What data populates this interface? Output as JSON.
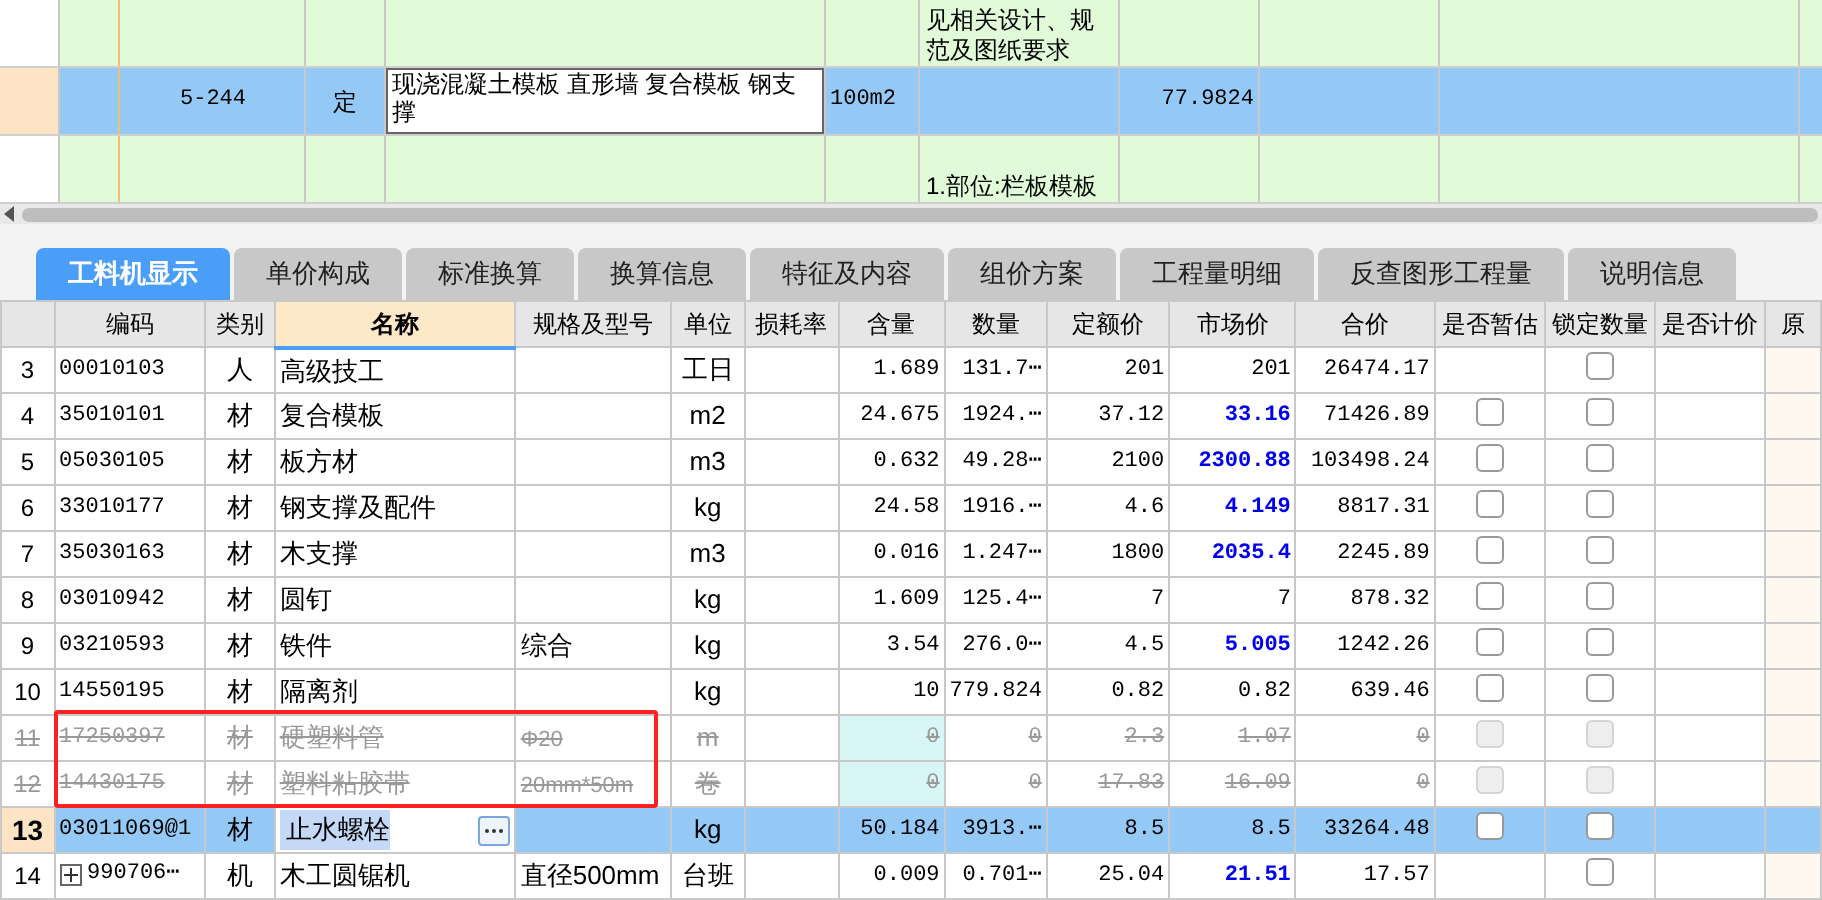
{
  "upper_grid": {
    "rows": [
      {
        "code": "",
        "type": "",
        "name": "",
        "unit": "",
        "description": "见相关设计、规范及图纸要求",
        "amount": "",
        "selected": false
      },
      {
        "code": "5-244",
        "type": "定",
        "name": "现浇混凝土模板 直形墙 复合模板 钢支撑",
        "unit": "100m2",
        "description": "",
        "amount": "77.9824",
        "selected": true
      },
      {
        "code": "",
        "type": "",
        "name": "",
        "unit": "",
        "description": "1.部位:栏板模板",
        "amount": "",
        "selected": false
      }
    ]
  },
  "tabs": [
    {
      "label": "工料机显示",
      "selected": true
    },
    {
      "label": "单价构成",
      "selected": false
    },
    {
      "label": "标准换算",
      "selected": false
    },
    {
      "label": "换算信息",
      "selected": false
    },
    {
      "label": "特征及内容",
      "selected": false
    },
    {
      "label": "组价方案",
      "selected": false
    },
    {
      "label": "工程量明细",
      "selected": false
    },
    {
      "label": "反查图形工程量",
      "selected": false
    },
    {
      "label": "说明信息",
      "selected": false
    }
  ],
  "table": {
    "columns": [
      {
        "label": "编码",
        "sorted": false
      },
      {
        "label": "类别",
        "sorted": false
      },
      {
        "label": "名称",
        "sorted": true
      },
      {
        "label": "规格及型号",
        "sorted": false
      },
      {
        "label": "单位",
        "sorted": false
      },
      {
        "label": "损耗率",
        "sorted": false
      },
      {
        "label": "含量",
        "sorted": false
      },
      {
        "label": "数量",
        "sorted": false
      },
      {
        "label": "定额价",
        "sorted": false
      },
      {
        "label": "市场价",
        "sorted": false
      },
      {
        "label": "合价",
        "sorted": false
      },
      {
        "label": "是否暂估",
        "sorted": false
      },
      {
        "label": "锁定数量",
        "sorted": false
      },
      {
        "label": "是否计价",
        "sorted": false
      },
      {
        "label": "原",
        "sorted": false
      }
    ],
    "rows": [
      {
        "no": "3",
        "code": "00010103",
        "type": "人",
        "name": "高级技工",
        "spec": "",
        "unit": "工日",
        "qty": "1.689",
        "amount": "131.7⋯",
        "quota": "201",
        "market": "201",
        "market_changed": false,
        "total": "26474.17",
        "estimate": null,
        "lock": {
          "checked": false
        },
        "struck": false,
        "selected": false,
        "expandable": false
      },
      {
        "no": "4",
        "code": "35010101",
        "type": "材",
        "name": "复合模板",
        "spec": "",
        "unit": "m2",
        "qty": "24.675",
        "amount": "1924.⋯",
        "quota": "37.12",
        "market": "33.16",
        "market_changed": true,
        "total": "71426.89",
        "estimate": {
          "checked": false
        },
        "lock": {
          "checked": false
        },
        "struck": false,
        "selected": false,
        "expandable": false
      },
      {
        "no": "5",
        "code": "05030105",
        "type": "材",
        "name": "板方材",
        "spec": "",
        "unit": "m3",
        "qty": "0.632",
        "amount": "49.28⋯",
        "quota": "2100",
        "market": "2300.88",
        "market_changed": true,
        "total": "103498.24",
        "estimate": {
          "checked": false
        },
        "lock": {
          "checked": false
        },
        "struck": false,
        "selected": false,
        "expandable": false
      },
      {
        "no": "6",
        "code": "33010177",
        "type": "材",
        "name": "钢支撑及配件",
        "spec": "",
        "unit": "kg",
        "qty": "24.58",
        "amount": "1916.⋯",
        "quota": "4.6",
        "market": "4.149",
        "market_changed": true,
        "total": "8817.31",
        "estimate": {
          "checked": false
        },
        "lock": {
          "checked": false
        },
        "struck": false,
        "selected": false,
        "expandable": false
      },
      {
        "no": "7",
        "code": "35030163",
        "type": "材",
        "name": "木支撑",
        "spec": "",
        "unit": "m3",
        "qty": "0.016",
        "amount": "1.247⋯",
        "quota": "1800",
        "market": "2035.4",
        "market_changed": true,
        "total": "2245.89",
        "estimate": {
          "checked": false
        },
        "lock": {
          "checked": false
        },
        "struck": false,
        "selected": false,
        "expandable": false
      },
      {
        "no": "8",
        "code": "03010942",
        "type": "材",
        "name": "圆钉",
        "spec": "",
        "unit": "kg",
        "qty": "1.609",
        "amount": "125.4⋯",
        "quota": "7",
        "market": "7",
        "market_changed": false,
        "total": "878.32",
        "estimate": {
          "checked": false
        },
        "lock": {
          "checked": false
        },
        "struck": false,
        "selected": false,
        "expandable": false
      },
      {
        "no": "9",
        "code": "03210593",
        "type": "材",
        "name": "铁件",
        "spec": "综合",
        "unit": "kg",
        "qty": "3.54",
        "amount": "276.0⋯",
        "quota": "4.5",
        "market": "5.005",
        "market_changed": true,
        "total": "1242.26",
        "estimate": {
          "checked": false
        },
        "lock": {
          "checked": false
        },
        "struck": false,
        "selected": false,
        "expandable": false
      },
      {
        "no": "10",
        "code": "14550195",
        "type": "材",
        "name": "隔离剂",
        "spec": "",
        "unit": "kg",
        "qty": "10",
        "amount": "779.824",
        "quota": "0.82",
        "market": "0.82",
        "market_changed": false,
        "total": "639.46",
        "estimate": {
          "checked": false
        },
        "lock": {
          "checked": false
        },
        "struck": false,
        "selected": false,
        "expandable": false
      },
      {
        "no": "11",
        "code": "17250397",
        "type": "材",
        "name": "硬塑料管",
        "spec": "Φ20",
        "unit": "m",
        "qty": "0",
        "amount": "0",
        "quota": "2.3",
        "market": "1.07",
        "market_changed": false,
        "total": "0",
        "estimate": {
          "checked": false
        },
        "lock": {
          "checked": false
        },
        "struck": true,
        "selected": false,
        "expandable": false
      },
      {
        "no": "12",
        "code": "14430175",
        "type": "材",
        "name": "塑料粘胶带",
        "spec": "20mm*50m",
        "unit": "卷",
        "qty": "0",
        "amount": "0",
        "quota": "17.83",
        "market": "16.09",
        "market_changed": false,
        "total": "0",
        "estimate": {
          "checked": false
        },
        "lock": {
          "checked": false
        },
        "struck": true,
        "selected": false,
        "expandable": false
      },
      {
        "no": "13",
        "code": "03011069@1",
        "type": "材",
        "name": "止水螺栓",
        "spec": "",
        "unit": "kg",
        "qty": "50.184",
        "amount": "3913.⋯",
        "quota": "8.5",
        "market": "8.5",
        "market_changed": false,
        "total": "33264.48",
        "estimate": {
          "checked": false
        },
        "lock": {
          "checked": false
        },
        "struck": false,
        "selected": true,
        "expandable": false
      },
      {
        "no": "14",
        "code": "990706⋯",
        "type": "机",
        "name": "木工圆锯机",
        "spec": "直径500mm",
        "unit": "台班",
        "qty": "0.009",
        "amount": "0.701⋯",
        "quota": "25.04",
        "market": "21.51",
        "market_changed": true,
        "total": "17.57",
        "estimate": null,
        "lock": {
          "checked": false
        },
        "struck": false,
        "selected": false,
        "expandable": true
      }
    ]
  }
}
